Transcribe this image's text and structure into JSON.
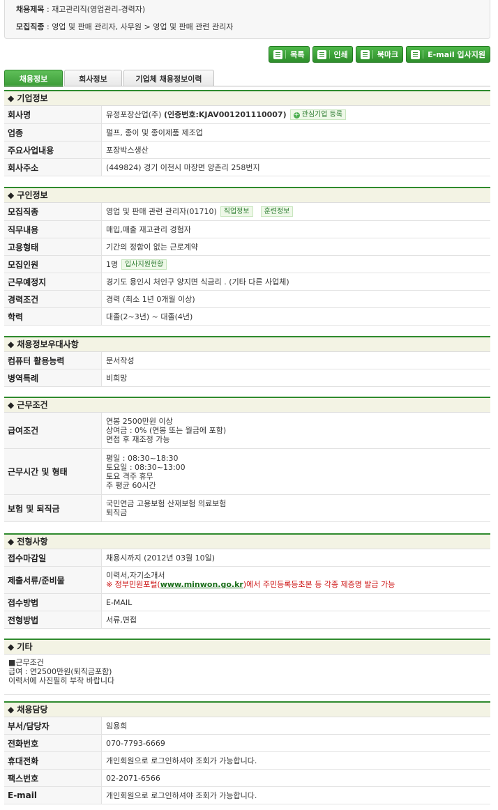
{
  "header": {
    "title_label": "채용제목",
    "title_value": "재고관리직(영업관리-경력자)",
    "job_label": "모집직종",
    "job_value": "영업 및 판매 관리자, 사무원 > 영업 및 판매 관련 관리자"
  },
  "buttons": {
    "list": "목록",
    "print": "인쇄",
    "bookmark": "북마크",
    "email_apply": "E-mail 입사지원"
  },
  "tabs": [
    "채용정보",
    "회사정보",
    "기업체 채용정보이력"
  ],
  "company": {
    "heading": "◆ 기업정보",
    "name_label": "회사명",
    "name_value": "유정포장산업(주)",
    "cert": "(인증번호:KJAV001201110007)",
    "interest_btn": "관심기업 등록",
    "industry_label": "업종",
    "industry_value": "펄프, 종이 및 종이제품 제조업",
    "business_label": "주요사업내용",
    "business_value": "포장박스생산",
    "address_label": "회사주소",
    "address_value": "(449824) 경기 이천시 마장면 양촌리 258번지"
  },
  "job": {
    "heading": "◆ 구인정보",
    "rows": [
      {
        "label": "모집직종",
        "value": "영업 및 판매 관련 관리자(01710)",
        "badges": [
          "직업정보",
          "훈련정보"
        ]
      },
      {
        "label": "직무내용",
        "value": "매입,매출 재고관리 경험자",
        "badges": []
      },
      {
        "label": "고용형태",
        "value": "기간의 정함이 없는 근로계약",
        "badges": []
      },
      {
        "label": "모집인원",
        "value": "1명",
        "badges": [
          "입사지원현황"
        ]
      },
      {
        "label": "근무예정지",
        "value": "경기도 용인시 처인구 양지면 식금리 . (기타 다른 사업체)",
        "badges": []
      },
      {
        "label": "경력조건",
        "value": "경력 (최소 1년 0개월 이상)",
        "badges": []
      },
      {
        "label": "학력",
        "value": "대졸(2~3년) ~ 대졸(4년)",
        "badges": []
      }
    ]
  },
  "pref": {
    "heading": "◆ 채용정보우대사항",
    "rows": [
      {
        "label": "컴퓨터 활용능력",
        "value": "문서작성"
      },
      {
        "label": "병역특례",
        "value": "비희망"
      }
    ]
  },
  "work": {
    "heading": "◆ 근무조건",
    "pay_label": "급여조건",
    "pay_lines": [
      "연봉 2500만원 이상",
      "상여금 : 0% (연봉 또는 월급에 포함)",
      "면접 후 재조정 가능"
    ],
    "hours_label": "근무시간 및 형태",
    "hours_lines": [
      "평일 : 08:30~18:30",
      "토요일 : 08:30~13:00",
      "토요 격주 휴무",
      "주 평균 60시간"
    ],
    "ins_label": "보험 및 퇴직금",
    "ins_lines": [
      "국민연금 고용보험 산재보험 의료보험",
      "퇴직금"
    ]
  },
  "process": {
    "heading": "◆ 전형사항",
    "deadline_label": "접수마감일",
    "deadline_value": "채용시까지 (2012년 03월 10일)",
    "docs_label": "제출서류/준비물",
    "docs_value": "이력서,자기소개서",
    "docs_note_pre": "※ 정부민원포털(",
    "docs_note_link": "www.minwon.go.kr",
    "docs_note_post": ")에서 주민등록등초본 등 각종 제증명 발급 가능",
    "method_label": "접수방법",
    "method_value": "E-MAIL",
    "select_label": "전형방법",
    "select_value": "서류,면접"
  },
  "etc": {
    "heading": "◆ 기타",
    "lines": [
      "■근무조건",
      "급여 : 연2500만원(퇴직금포함)",
      "이력서에 사진필히 부착 바랍니다"
    ]
  },
  "contact": {
    "heading": "◆ 채용담당",
    "rows": [
      {
        "label": "부서/담당자",
        "value": "임용희"
      },
      {
        "label": "전화번호",
        "value": "070-7793-6669"
      },
      {
        "label": "휴대전화",
        "value": "개인회원으로 로그인하셔야 조회가 가능합니다."
      },
      {
        "label": "팩스번호",
        "value": "02-2071-6566"
      },
      {
        "label": "E-mail",
        "value": "개인회원으로 로그인하셔야 조회가 가능합니다."
      }
    ]
  }
}
